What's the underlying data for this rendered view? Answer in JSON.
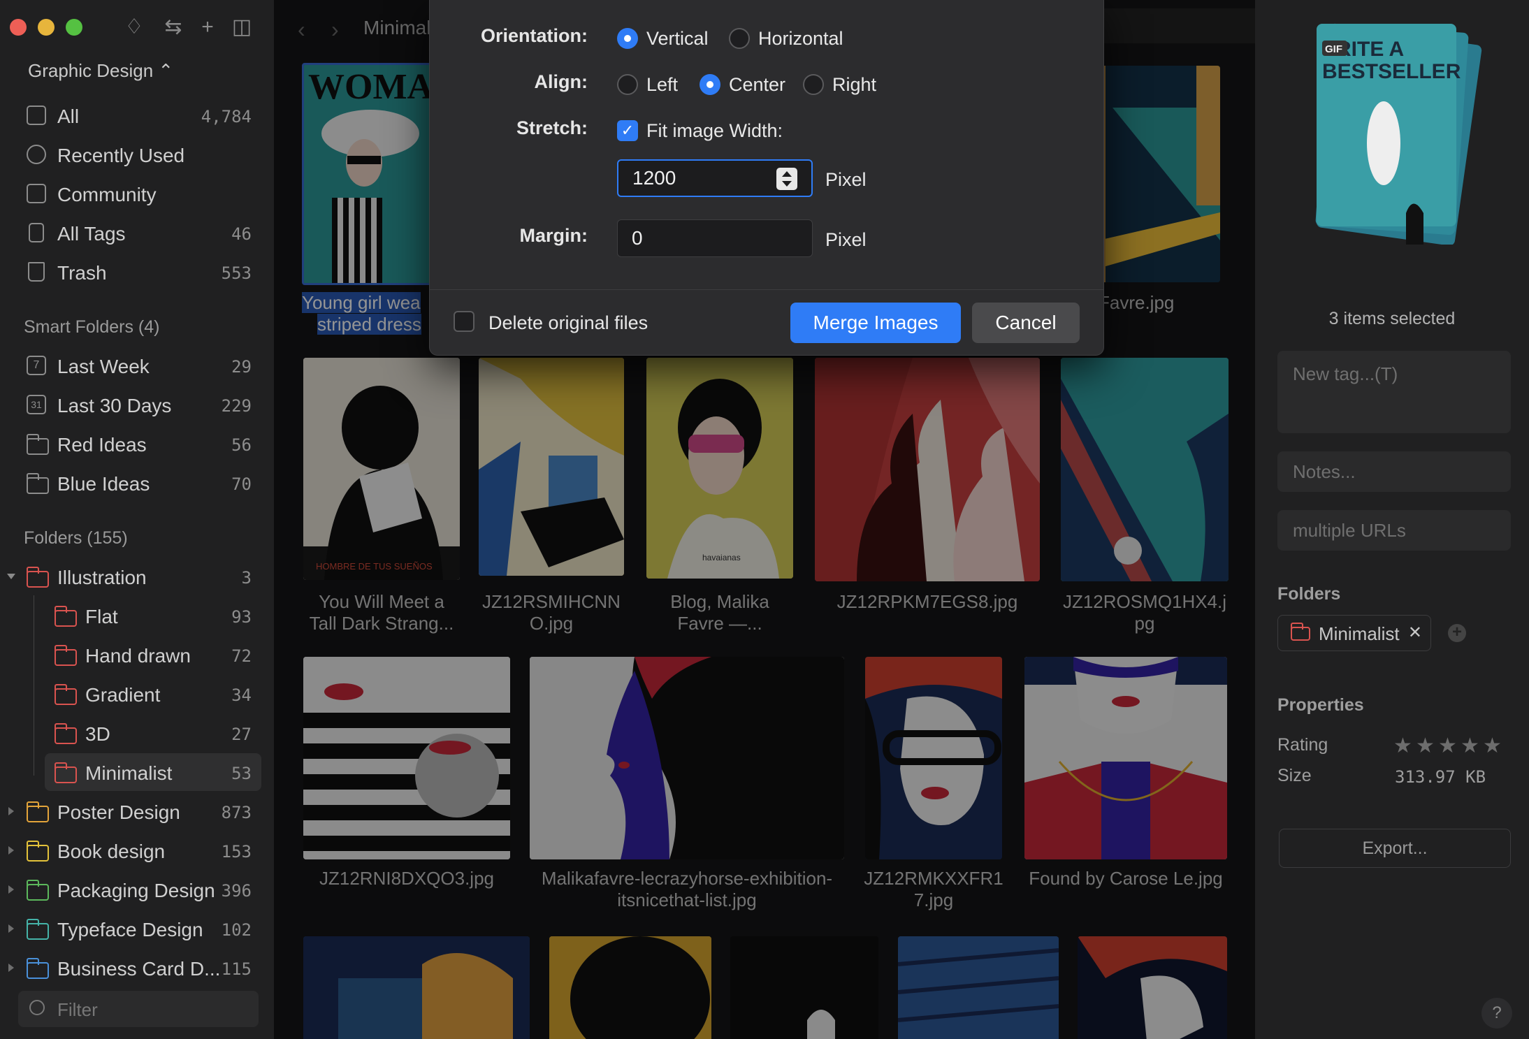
{
  "library": {
    "title": "Graphic Design ⌃"
  },
  "sidebar": {
    "items": [
      {
        "label": "All",
        "count": "4,784",
        "icon": "inbox-icon"
      },
      {
        "label": "Recently Used",
        "count": "",
        "icon": "clock-icon"
      },
      {
        "label": "Community",
        "count": "",
        "icon": "download-icon"
      },
      {
        "label": "All Tags",
        "count": "46",
        "icon": "bookmark-icon"
      },
      {
        "label": "Trash",
        "count": "553",
        "icon": "trash-icon"
      }
    ],
    "smart_header": "Smart Folders (4)",
    "smart": [
      {
        "label": "Last Week",
        "count": "29",
        "icon": "calendar-7-icon",
        "glyph": "7"
      },
      {
        "label": "Last 30 Days",
        "count": "229",
        "icon": "calendar-31-icon",
        "glyph": "31"
      },
      {
        "label": "Red Ideas",
        "count": "56",
        "icon": "smart-folder-icon"
      },
      {
        "label": "Blue Ideas",
        "count": "70",
        "icon": "smart-folder-icon"
      }
    ],
    "folders_header": "Folders (155)",
    "folders": [
      {
        "label": "Illustration",
        "count": "3",
        "color": "#d9534f"
      },
      {
        "label": "Flat",
        "count": "93",
        "color": "#d9534f"
      },
      {
        "label": "Hand drawn",
        "count": "72",
        "color": "#d9534f"
      },
      {
        "label": "Gradient",
        "count": "34",
        "color": "#d9534f"
      },
      {
        "label": "3D",
        "count": "27",
        "color": "#d9534f"
      },
      {
        "label": "Minimalist",
        "count": "53",
        "color": "#d9534f"
      },
      {
        "label": "Poster Design",
        "count": "873",
        "color": "#e3a43a"
      },
      {
        "label": "Book design",
        "count": "153",
        "color": "#e3c23a"
      },
      {
        "label": "Packaging Design",
        "count": "396",
        "color": "#5cb85c"
      },
      {
        "label": "Typeface Design",
        "count": "102",
        "color": "#45b3a8"
      },
      {
        "label": "Business Card D...",
        "count": "115",
        "color": "#4a90d9"
      }
    ],
    "filter_placeholder": "Filter"
  },
  "toolbar": {
    "breadcrumb": "Minimal"
  },
  "grid": {
    "row0": [
      {
        "name_line1": "Young girl wea",
        "name_line2": "striped dress"
      },
      {
        "name_line1": "Favre.jpg",
        "name_line2": ""
      }
    ],
    "row1": [
      {
        "line1": "You Will Meet a",
        "line2": "Tall Dark Strang..."
      },
      {
        "line1": "JZ12RSMIHCNN",
        "line2": "O.jpg"
      },
      {
        "line1": "Blog, Malika",
        "line2": "Favre —..."
      },
      {
        "line1": "JZ12RPKM7EGS8.jpg",
        "line2": ""
      },
      {
        "line1": "JZ12ROSMQ1HX4.j",
        "line2": "pg"
      }
    ],
    "row2": [
      {
        "line1": "JZ12RNI8DXQO3.jpg",
        "line2": ""
      },
      {
        "line1": "Malikafavre-lecrazyhorse-exhibition-",
        "line2": "itsnicethat-list.jpg"
      },
      {
        "line1": "JZ12RMKXXFR1",
        "line2": "7.jpg"
      },
      {
        "line1": "Found by Carose Le.jpg",
        "line2": ""
      }
    ],
    "poster_text": {
      "woman": "WOMA",
      "hombre": "HOMBRE DE TUS SUEÑOS",
      "hav": "havaianas",
      "bestseller": "BESTSELLER",
      "gif": "GIF",
      "write_a": "RITE A"
    }
  },
  "dialog": {
    "orientation_label": "Orientation:",
    "vertical": "Vertical",
    "horizontal": "Horizontal",
    "align_label": "Align:",
    "left": "Left",
    "center": "Center",
    "right": "Right",
    "stretch_label": "Stretch:",
    "fit_width": "Fit image Width:",
    "width_value": "1200",
    "pixel": "Pixel",
    "margin_label": "Margin:",
    "margin_value": "0",
    "delete_originals": "Delete original files",
    "merge": "Merge Images",
    "cancel": "Cancel"
  },
  "inspector": {
    "selected": "3 items selected",
    "tag_placeholder": "New tag...(T)",
    "notes_placeholder": "Notes...",
    "urls_placeholder": "multiple URLs",
    "folders_header": "Folders",
    "folder_chip": "Minimalist",
    "properties_header": "Properties",
    "rating_label": "Rating",
    "rating_value": 0,
    "size_label": "Size",
    "size_value": "313.97 KB",
    "export": "Export...",
    "help": "?"
  }
}
